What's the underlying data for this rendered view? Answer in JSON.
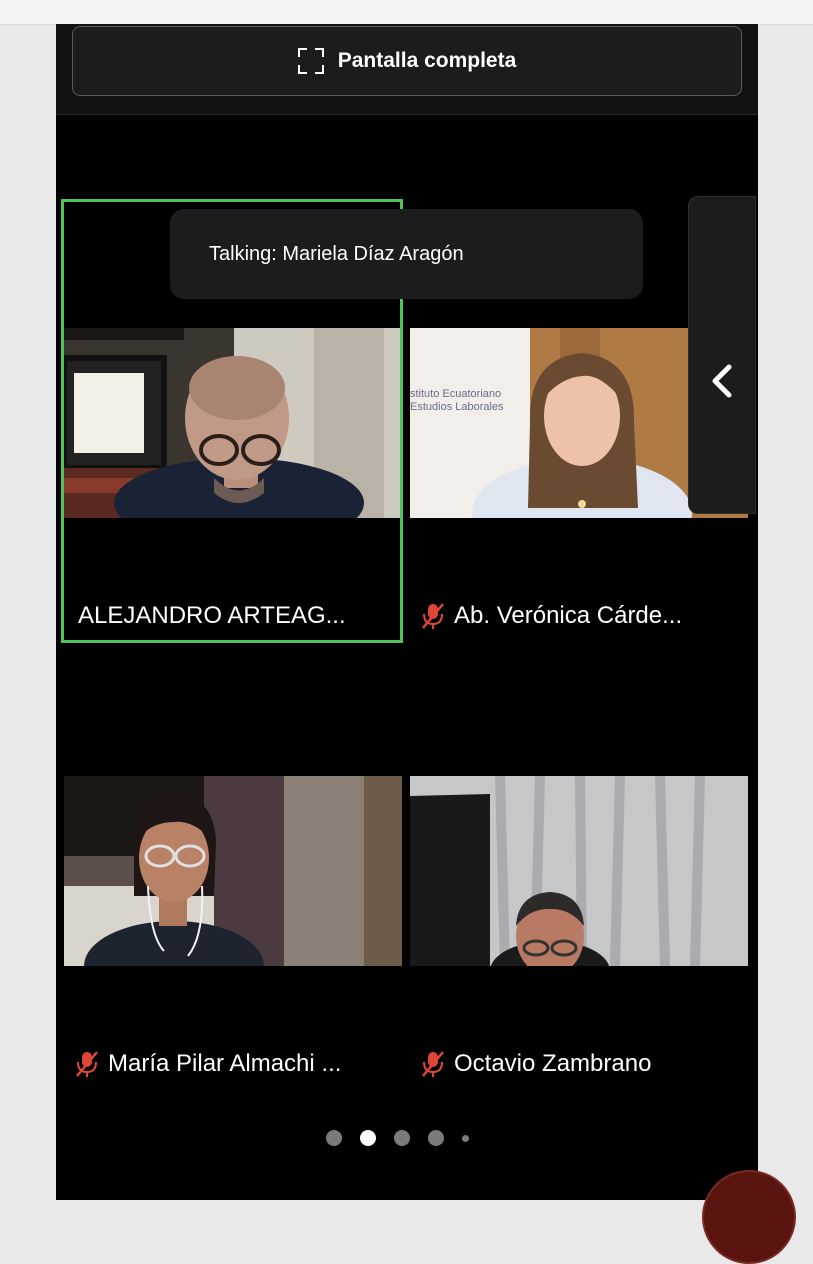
{
  "fullscreen": {
    "label": "Pantalla completa",
    "icon": "fullscreen-icon"
  },
  "toast": {
    "text": "Talking: Mariela Díaz Aragón"
  },
  "participants": [
    {
      "name": "ALEJANDRO ARTEAG...",
      "muted": false,
      "speaking": true
    },
    {
      "name": "Ab. Verónica Cárde...",
      "muted": true,
      "speaking": false,
      "background_text": "stituto Ecuatoriano\nEstudios Laborales"
    },
    {
      "name": "María Pilar Almachi ...",
      "muted": true,
      "speaking": false
    },
    {
      "name": "Octavio Zambrano",
      "muted": true,
      "speaking": false
    }
  ],
  "pagination": {
    "pages": 5,
    "active_page": 2
  },
  "colors": {
    "speaking_border": "#4fc35c",
    "muted_icon": "#e0453a"
  },
  "icons": {
    "mic_muted": "mic-off-icon",
    "chevron": "chevron-left-icon"
  }
}
